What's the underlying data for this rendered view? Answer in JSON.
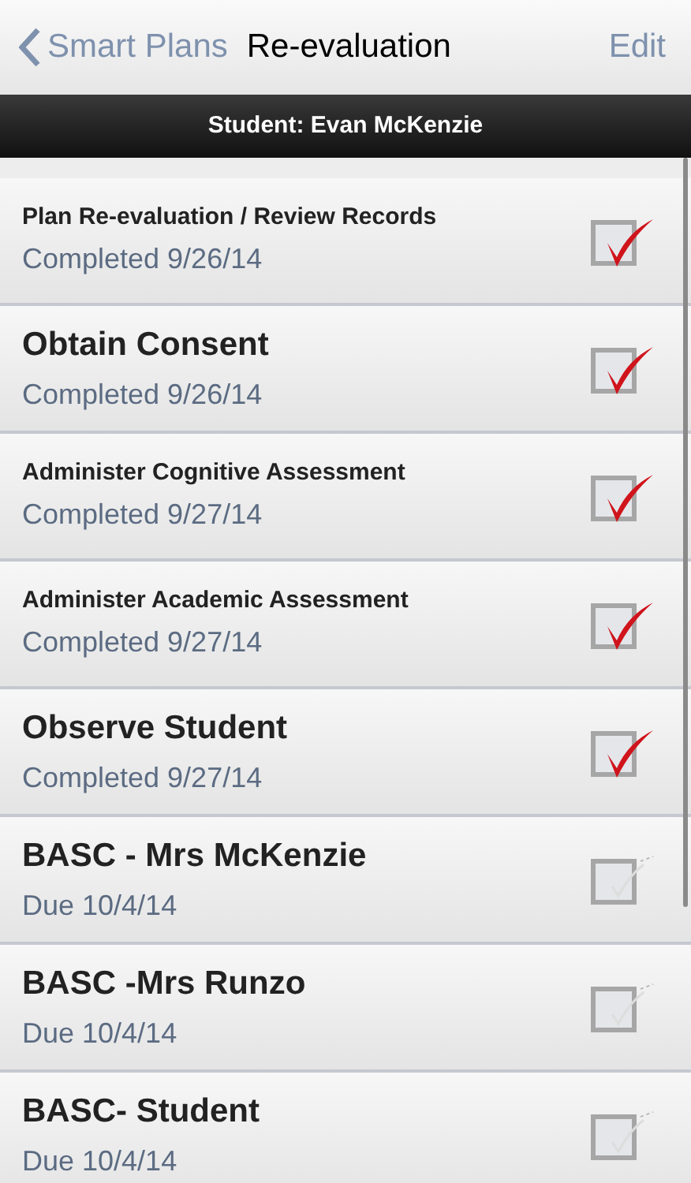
{
  "nav": {
    "back": "Smart Plans",
    "title": "Re-evaluation",
    "action": "Edit"
  },
  "header": "Student: Evan McKenzie",
  "tasks": [
    {
      "title": "Plan Re-evaluation / Review Records",
      "kind": "compact",
      "status": "Completed 9/26/14",
      "checked": true
    },
    {
      "title": "Obtain Consent",
      "kind": "large",
      "status": "Completed 9/26/14",
      "checked": true
    },
    {
      "title": "Administer Cognitive Assessment",
      "kind": "compact",
      "status": "Completed 9/27/14",
      "checked": true
    },
    {
      "title": "Administer Academic Assessment",
      "kind": "compact",
      "status": "Completed 9/27/14",
      "checked": true
    },
    {
      "title": "Observe Student",
      "kind": "large",
      "status": "Completed 9/27/14",
      "checked": true
    },
    {
      "title": "BASC - Mrs McKenzie",
      "kind": "large",
      "status": "Due 10/4/14",
      "checked": false
    },
    {
      "title": "BASC -Mrs Runzo",
      "kind": "large",
      "status": "Due 10/4/14",
      "checked": false
    },
    {
      "title": "BASC- Student",
      "kind": "large",
      "status": "Due 10/4/14",
      "checked": false
    }
  ]
}
